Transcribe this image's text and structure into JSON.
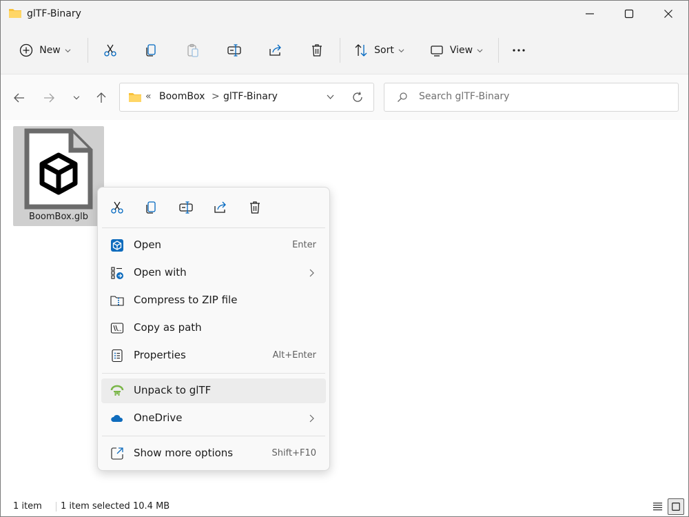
{
  "window": {
    "title": "glTF-Binary"
  },
  "toolbar": {
    "new_label": "New",
    "sort_label": "Sort",
    "view_label": "View"
  },
  "address": {
    "overflow": "«",
    "crumbs": [
      "BoomBox",
      "glTF-Binary"
    ],
    "separator": ">"
  },
  "search": {
    "placeholder": "Search glTF-Binary"
  },
  "files": [
    {
      "name": "BoomBox.glb",
      "icon": "3d-cube-file-icon"
    }
  ],
  "context_menu": {
    "items": [
      {
        "label": "Open",
        "shortcut": "Enter",
        "icon": "3d-viewer-icon"
      },
      {
        "label": "Open with",
        "shortcut": "",
        "icon": "open-with-icon",
        "submenu": true
      },
      {
        "label": "Compress to ZIP file",
        "shortcut": "",
        "icon": "zip-icon"
      },
      {
        "label": "Copy as path",
        "shortcut": "",
        "icon": "copy-path-icon"
      },
      {
        "label": "Properties",
        "shortcut": "Alt+Enter",
        "icon": "properties-icon"
      },
      {
        "label": "Unpack to glTF",
        "shortcut": "",
        "icon": "gltf-icon"
      },
      {
        "label": "OneDrive",
        "shortcut": "",
        "icon": "onedrive-icon",
        "submenu": true
      },
      {
        "label": "Show more options",
        "shortcut": "Shift+F10",
        "icon": "show-more-icon"
      }
    ]
  },
  "status": {
    "count": "1 item",
    "selected": "1 item selected",
    "size": "10.4 MB"
  },
  "colors": {
    "accent": "#0067c0",
    "folder": "#f8c13a",
    "gltf_green": "#7ab648",
    "onedrive": "#0f6cbd"
  }
}
